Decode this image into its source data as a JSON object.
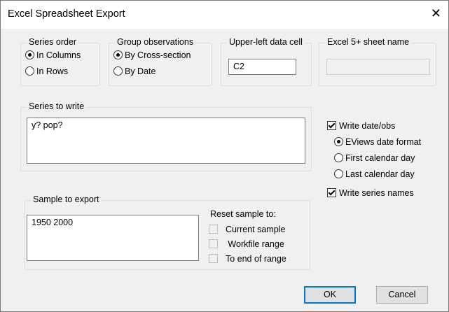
{
  "window": {
    "title": "Excel Spreadsheet Export",
    "close_glyph": "✕"
  },
  "series_order": {
    "legend": "Series order",
    "options": [
      "In Columns",
      "In Rows"
    ],
    "selected": "In Columns"
  },
  "group_obs": {
    "legend": "Group observations",
    "options": [
      "By Cross-section",
      "By Date"
    ],
    "selected": "By Cross-section"
  },
  "upper_left": {
    "legend": "Upper-left data cell",
    "value": "C2"
  },
  "sheet_name": {
    "legend": "Excel 5+ sheet name",
    "value": ""
  },
  "series_to_write": {
    "legend": "Series to write",
    "value": "y? pop?"
  },
  "write_options": {
    "write_date_obs": {
      "label": "Write date/obs",
      "checked": true
    },
    "date_formats": [
      "EViews date format",
      "First calendar day",
      "Last calendar day"
    ],
    "date_format_selected": "EViews date format",
    "write_series_names": {
      "label": "Write series names",
      "checked": true
    }
  },
  "sample": {
    "legend": "Sample to export",
    "value": "1950 2000",
    "reset_label": "Reset sample to:",
    "reset_options": [
      "Current sample",
      "Workfile range",
      "To end of range"
    ]
  },
  "buttons": {
    "ok": "OK",
    "cancel": "Cancel"
  }
}
